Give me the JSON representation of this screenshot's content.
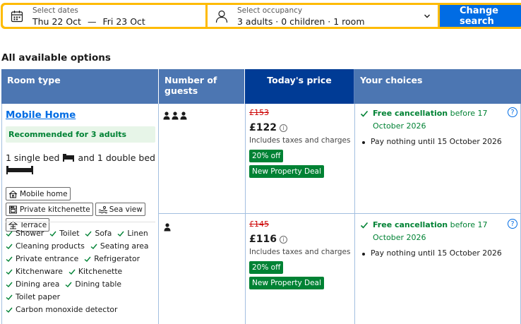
{
  "search": {
    "dates_label": "Select dates",
    "check_in": "Thu 22 Oct",
    "dash": "—",
    "check_out": "Fri 23 Oct",
    "occupancy_label": "Select occupancy",
    "occupancy_value": "3 adults · 0 children · 1 room",
    "button_label": "Change search"
  },
  "section_title": "All available options",
  "table": {
    "headers": [
      "Room type",
      "Number of guests",
      "Today's price",
      "Your choices"
    ]
  },
  "room": {
    "name": "Mobile Home",
    "recommendation": "Recommended for 3 adults",
    "beds_part1": "1 single bed",
    "beds_part2": "and 1 double bed",
    "tags": [
      "Mobile home",
      "Private kitchenette",
      "Sea view",
      "Terrace"
    ],
    "amenities": [
      "Shower",
      "Toilet",
      "Sofa",
      "Linen",
      "Cleaning products",
      "Seating area",
      "Private entrance",
      "Refrigerator",
      "Kitchenware",
      "Kitchenette",
      "Dining area",
      "Dining table",
      "Toilet paper",
      "Carbon monoxide detector"
    ]
  },
  "options": [
    {
      "guests": 3,
      "old_price": "£153",
      "price": "£122",
      "tax_note": "Includes taxes and charges",
      "discount": "20% off",
      "deal": "New Property Deal",
      "cancel_bold": "Free cancellation",
      "cancel_rest": " before 17 October 2026",
      "pay_note": "Pay nothing until 15 October 2026"
    },
    {
      "guests": 1,
      "old_price": "£145",
      "price": "£116",
      "tax_note": "Includes taxes and charges",
      "discount": "20% off",
      "deal": "New Property Deal",
      "cancel_bold": "Free cancellation",
      "cancel_rest": " before 17 October 2026",
      "pay_note": "Pay nothing until 15 October 2026"
    }
  ],
  "icons": {
    "calendar": "calendar-icon",
    "person": "person-icon",
    "chevron": "chevron-down-icon",
    "info": "info-icon",
    "help": "question-icon"
  },
  "colors": {
    "accent": "#006ce4",
    "search_border": "#febb02",
    "header_blue": "#4c76b2",
    "header_dark": "#003b95",
    "green": "#008234",
    "strike_red": "#cc0000"
  }
}
